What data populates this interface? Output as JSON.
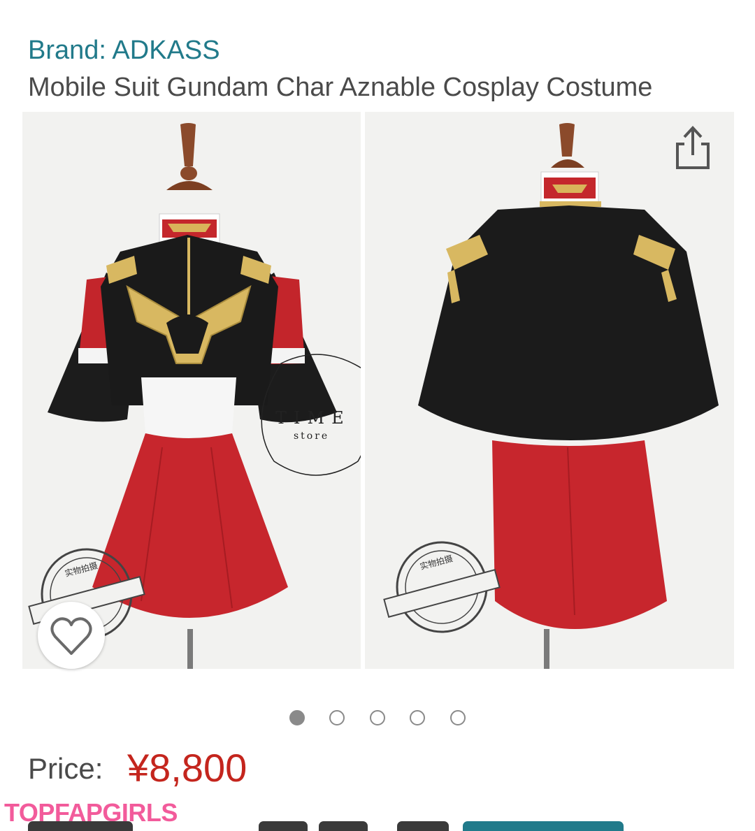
{
  "product": {
    "brand_label": "Brand: ADKASS",
    "title": "Mobile Suit Gundam Char Aznable Cosplay Costume"
  },
  "gallery": {
    "images": [
      {
        "name": "costume-front",
        "overlay_text": "TIME",
        "overlay_subtext": "store",
        "stamp_text": "实物拍摄"
      },
      {
        "name": "costume-back",
        "stamp_text": "实物拍摄"
      }
    ],
    "image_count": 5,
    "active_index": 0
  },
  "price": {
    "label": "Price:",
    "value": "¥8,800"
  },
  "watermark": "TOPFAPGIRLS",
  "icons": {
    "share": "share-icon",
    "wishlist": "heart-icon"
  },
  "colors": {
    "brand_link": "#217a8a",
    "price": "#c4251d",
    "watermark": "#f25b9b",
    "dot": "#8a8a8a"
  }
}
